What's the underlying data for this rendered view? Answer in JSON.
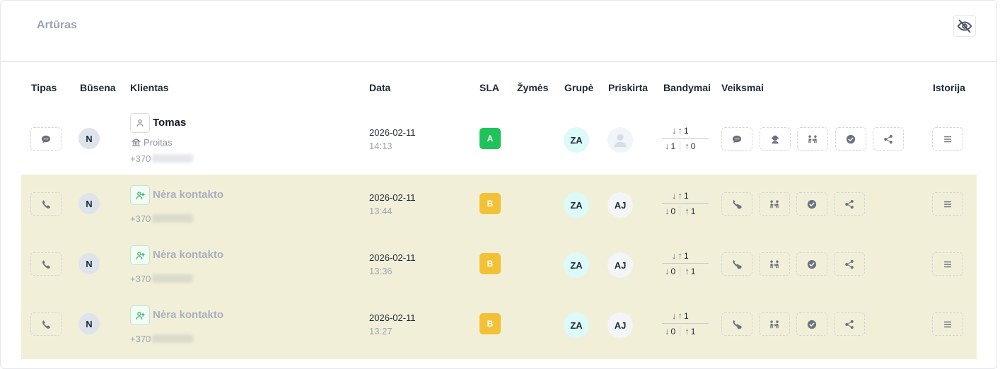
{
  "panel": {
    "title": "Artūras"
  },
  "columns": {
    "type": "Tipas",
    "status": "Būsena",
    "client": "Klientas",
    "date": "Data",
    "sla": "SLA",
    "tags": "Žymės",
    "group": "Grupė",
    "assigned": "Priskirta",
    "attempts": "Bandymai",
    "actions": "Veiksmai",
    "history": "Istorija"
  },
  "rows": [
    {
      "type_icon": "chat-icon",
      "status": "N",
      "client_icon": "person-icon",
      "client_name": "Tomas",
      "org": "Proitas",
      "phone_prefix": "+370",
      "date": "2026-02-11",
      "time": "14:13",
      "sla": "A",
      "sla_color": "#1fc35a",
      "group": "ZA",
      "assigned": "",
      "attempts": {
        "top_up": "1",
        "bottom_down": "1",
        "bottom_up": "0"
      },
      "actions": [
        "chat-icon",
        "agent-icon",
        "transfer-icon",
        "check-circle-icon",
        "share-icon"
      ]
    },
    {
      "type_icon": "phone-icon",
      "status": "N",
      "client_icon": "add-contact-icon",
      "client_name": "Nėra kontakto",
      "phone_prefix": "+370",
      "date": "2026-02-11",
      "time": "13:44",
      "sla": "B",
      "sla_color": "#f2c135",
      "group": "ZA",
      "assigned": "AJ",
      "attempts": {
        "top_up": "1",
        "bottom_down": "0",
        "bottom_up": "1"
      },
      "actions": [
        "callback-icon",
        "transfer-icon",
        "check-circle-icon",
        "share-icon"
      ]
    },
    {
      "type_icon": "phone-icon",
      "status": "N",
      "client_icon": "add-contact-icon",
      "client_name": "Nėra kontakto",
      "phone_prefix": "+370",
      "date": "2026-02-11",
      "time": "13:36",
      "sla": "B",
      "sla_color": "#f2c135",
      "group": "ZA",
      "assigned": "AJ",
      "attempts": {
        "top_up": "1",
        "bottom_down": "0",
        "bottom_up": "1"
      },
      "actions": [
        "callback-icon",
        "transfer-icon",
        "check-circle-icon",
        "share-icon"
      ]
    },
    {
      "type_icon": "phone-icon",
      "status": "N",
      "client_icon": "add-contact-icon",
      "client_name": "Nėra kontakto",
      "phone_prefix": "+370",
      "date": "2026-02-11",
      "time": "13:27",
      "sla": "B",
      "sla_color": "#f2c135",
      "group": "ZA",
      "assigned": "AJ",
      "attempts": {
        "top_up": "1",
        "bottom_down": "0",
        "bottom_up": "1"
      },
      "actions": [
        "callback-icon",
        "transfer-icon",
        "check-circle-icon",
        "share-icon"
      ]
    }
  ]
}
